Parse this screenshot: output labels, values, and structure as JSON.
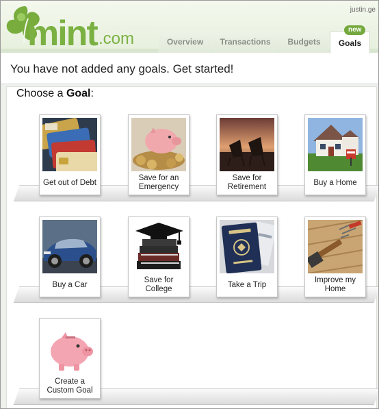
{
  "header": {
    "logo": {
      "word": "mint",
      "suffix": ".com"
    },
    "user": "justin.ge",
    "tabs": [
      {
        "label": "Overview"
      },
      {
        "label": "Transactions"
      },
      {
        "label": "Budgets"
      },
      {
        "label": "Goals",
        "badge": "new",
        "active": true
      }
    ]
  },
  "notice": "You have not added any goals. Get started!",
  "choose": {
    "prefix": "Choose a ",
    "bold": "Goal",
    "suffix": ":"
  },
  "goals": [
    {
      "label": "Get out of Debt",
      "icon": "credit-cards-image"
    },
    {
      "label": "Save for an Emergency",
      "icon": "piggy-bank-coins-image"
    },
    {
      "label": "Save for Retirement",
      "icon": "beach-chairs-sunset-image"
    },
    {
      "label": "Buy a Home",
      "icon": "house-for-sale-image"
    },
    {
      "label": "Buy a Car",
      "icon": "blue-car-image"
    },
    {
      "label": "Save for College",
      "icon": "books-graduation-cap-image"
    },
    {
      "label": "Take a Trip",
      "icon": "passport-image"
    },
    {
      "label": "Improve my Home",
      "icon": "hammer-nails-image"
    },
    {
      "label": "Create a Custom Goal",
      "icon": "pink-piggy-bank-image"
    }
  ],
  "colors": {
    "brand": "#7bb143",
    "badge": "#74a83c"
  }
}
